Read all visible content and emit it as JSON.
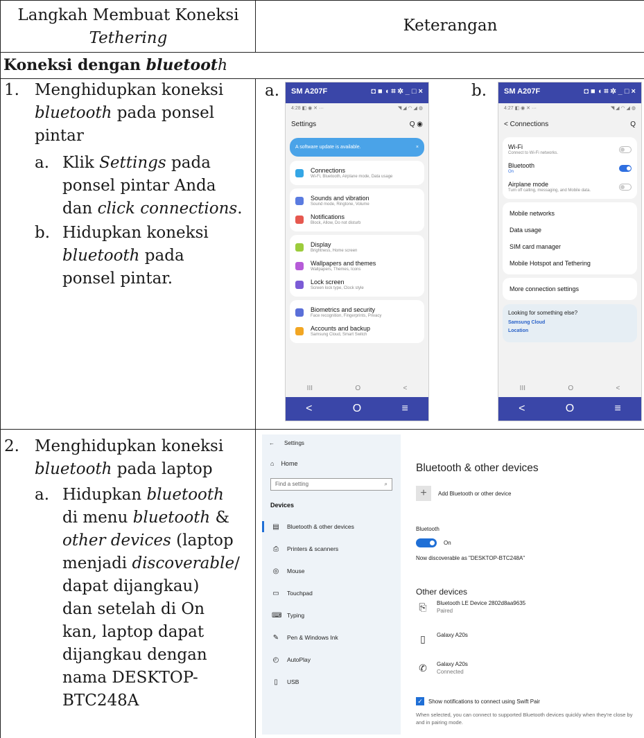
{
  "table": {
    "header_left": [
      "Langkah Membuat Koneksi",
      "Tethering"
    ],
    "header_right": "Keterangan",
    "section_title": [
      "Koneksi dengan ",
      "bluetoot",
      "h"
    ]
  },
  "step1": {
    "num": "1.",
    "lines": [
      "Menghidupkan koneksi",
      [
        [
          "bluetooth",
          true
        ],
        [
          " pada ponsel",
          false
        ]
      ],
      "pintar"
    ],
    "sub_a": {
      "label": "a.",
      "lines": [
        [
          [
            "Klik ",
            false
          ],
          [
            "Settings",
            true
          ],
          [
            " pada",
            false
          ]
        ],
        "ponsel pintar Anda",
        [
          [
            "dan ",
            false
          ],
          [
            "click connections",
            true
          ],
          [
            ".",
            false
          ]
        ]
      ]
    },
    "sub_b": {
      "label": "b.",
      "lines": [
        "Hidupkan koneksi",
        [
          [
            "bluetooth",
            true
          ],
          [
            " pada",
            false
          ]
        ],
        "ponsel pintar."
      ]
    }
  },
  "step2": {
    "num": "2.",
    "lines": [
      "Menghidupkan koneksi",
      [
        [
          "bluetooth",
          true
        ],
        [
          " pada laptop",
          false
        ]
      ]
    ],
    "sub_a": {
      "label": "a.",
      "lines": [
        [
          [
            "Hidupkan ",
            false
          ],
          [
            "bluetooth",
            true
          ]
        ],
        [
          [
            "di menu ",
            false
          ],
          [
            "bluetooth",
            true
          ],
          [
            " &",
            false
          ]
        ],
        [
          [
            "other devices",
            true
          ],
          [
            " (laptop",
            false
          ]
        ],
        [
          [
            "menjadi ",
            false
          ],
          [
            "discoverable",
            true
          ],
          [
            "/",
            false
          ]
        ],
        "dapat dijangkau)",
        "dan setelah di On",
        "kan, laptop dapat",
        "dijangkau dengan",
        "nama DESKTOP-",
        "BTC248A"
      ]
    }
  },
  "panels": {
    "a_label": "a.",
    "b_label": "b."
  },
  "phone_a": {
    "title": "SM A207F",
    "title_icons": "◘ ■ ◖ ⌗ ✲  _ □ ×",
    "time": "4:28 ◧ ◉ ✕ ···",
    "signal": "◥ ◢ ◠ ◢ ◍",
    "header": "Settings",
    "header_icons": "Q ◉",
    "banner": "A software update is available.",
    "banner_close": "×",
    "items": [
      {
        "title": "Connections",
        "sub": "Wi-Fi, Bluetooth, Airplane mode, Data usage",
        "color": "#34a6e5"
      },
      {
        "title": "Sounds and vibration",
        "sub": "Sound mode, Ringtone, Volume",
        "color": "#5a7be0"
      },
      {
        "title": "Notifications",
        "sub": "Block, Allow, Do not disturb",
        "color": "#e6584f"
      },
      {
        "title": "Display",
        "sub": "Brightness, Home screen",
        "color": "#9ccc3c"
      },
      {
        "title": "Wallpapers and themes",
        "sub": "Wallpapers, Themes, Icons",
        "color": "#b65bd8"
      },
      {
        "title": "Lock screen",
        "sub": "Screen lock type, Clock style",
        "color": "#7b5bd6"
      },
      {
        "title": "Biometrics and security",
        "sub": "Face recognition, Fingerprints, Privacy",
        "color": "#5a6fd8"
      },
      {
        "title": "Accounts and backup",
        "sub": "Samsung Cloud, Smart Switch",
        "color": "#f2a623"
      }
    ],
    "nav": [
      "III",
      "O",
      "<"
    ],
    "bar": [
      "<",
      "O",
      "≡"
    ]
  },
  "phone_b": {
    "title": "SM A207F",
    "title_icons": "◘ ■ ◖ ⌗ ✲  _ □ ×",
    "time": "4:27 ◧ ◉ ✕ ···",
    "signal": "◥ ◢ ◠ ◢ ◍",
    "header": "< Connections",
    "header_icon": "Q",
    "toggles": [
      {
        "title": "Wi-Fi",
        "sub": "Connect to Wi-Fi networks.",
        "on": false
      },
      {
        "title": "Bluetooth",
        "sub": "On",
        "on": true
      },
      {
        "title": "Airplane mode",
        "sub": "Turn off calling, messaging, and Mobile data.",
        "on": false
      }
    ],
    "items": [
      "Mobile networks",
      "Data usage",
      "SIM card manager",
      "Mobile Hotspot and Tethering"
    ],
    "more": "More connection settings",
    "look_title": "Looking for something else?",
    "look_links": [
      "Samsung Cloud",
      "Location"
    ],
    "nav": [
      "III",
      "O",
      "<"
    ],
    "bar": [
      "<",
      "O",
      "≡"
    ]
  },
  "win": {
    "back": "←",
    "app": "Settings",
    "home_icon": "⌂",
    "home": "Home",
    "search_placeholder": "Find a setting",
    "search_icon": "⌕",
    "section": "Devices",
    "nav": [
      {
        "icon": "▤",
        "label": "Bluetooth & other devices"
      },
      {
        "icon": "⎙",
        "label": "Printers & scanners"
      },
      {
        "icon": "◎",
        "label": "Mouse"
      },
      {
        "icon": "▭",
        "label": "Touchpad"
      },
      {
        "icon": "⌨",
        "label": "Typing"
      },
      {
        "icon": "✎",
        "label": "Pen & Windows Ink"
      },
      {
        "icon": "◴",
        "label": "AutoPlay"
      },
      {
        "icon": "▯",
        "label": "USB"
      }
    ],
    "title": "Bluetooth & other devices",
    "add": "Add Bluetooth or other device",
    "add_icon": "+",
    "bt_label": "Bluetooth",
    "bt_state": "On",
    "discoverable": "Now discoverable as \"DESKTOP-BTC248A\"",
    "other": "Other devices",
    "devices": [
      {
        "icon": "⎘",
        "name": "Bluetooth LE Device 2802d8aa9635",
        "status": "Paired"
      },
      {
        "icon": "▯",
        "name": "Galaxy A20s",
        "status": ""
      },
      {
        "icon": "✆",
        "name": "Galaxy A20s",
        "status": "Connected"
      }
    ],
    "check_mark": "✓",
    "swift": "Show notifications to connect using Swift Pair",
    "note": "When selected, you can connect to supported Bluetooth devices quickly when they're close by and in pairing mode."
  }
}
